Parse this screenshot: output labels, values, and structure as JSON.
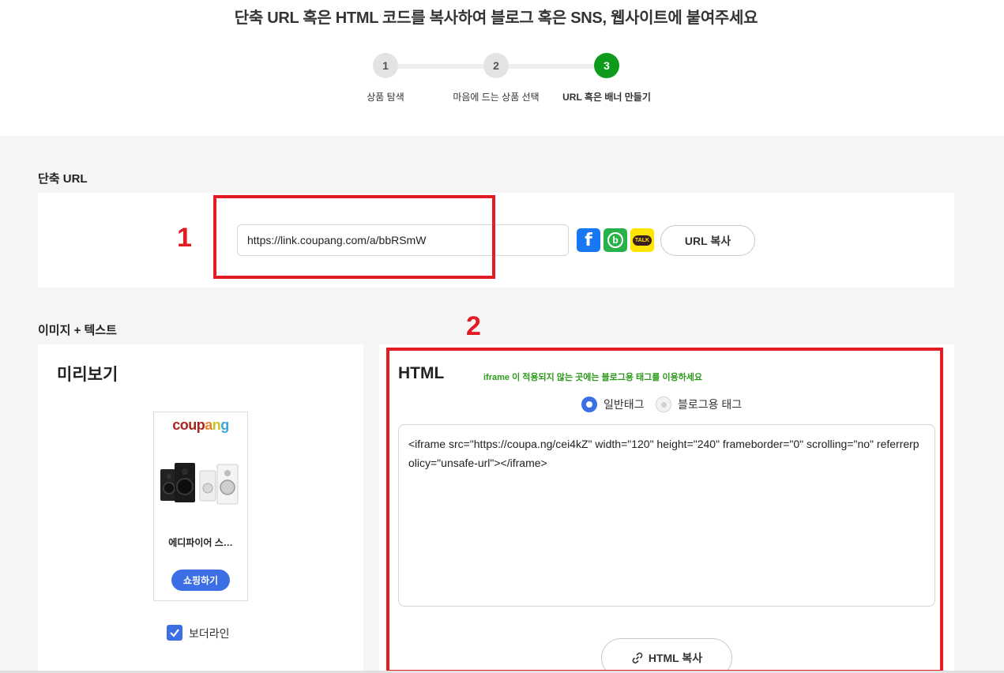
{
  "header": {
    "title": "단축 URL 혹은 HTML 코드를 복사하여 블로그 혹은 SNS, 웹사이트에 붙여주세요",
    "steps": [
      {
        "number": "1",
        "label": "상품 탐색",
        "active": false
      },
      {
        "number": "2",
        "label": "마음에 드는 상품 선택",
        "active": false
      },
      {
        "number": "3",
        "label": "URL 혹은 배너 만들기",
        "active": true
      }
    ]
  },
  "short_url": {
    "section_title": "단축 URL",
    "value": "https://link.coupang.com/a/bbRSmW",
    "share_icons": [
      "facebook-icon",
      "band-icon",
      "kakaotalk-icon"
    ],
    "kakao_text": "TALK",
    "copy_label": "URL 복사"
  },
  "image_text": {
    "section_title": "이미지 + 텍스트",
    "preview": {
      "title": "미리보기",
      "logo": "coupang",
      "product_name": "에디파이어 스…",
      "shop_button": "쇼핑하기",
      "border_checkbox_label": "보더라인",
      "border_checked": true
    },
    "html": {
      "title": "HTML",
      "note": "iframe 이 적용되지 않는 곳에는 블로그용 태그를 이용하세요",
      "radio_normal": "일반태그",
      "radio_blog": "블로그용 태그",
      "selected": "일반태그",
      "code": "<iframe src=\"https://coupa.ng/cei4kZ\" width=\"120\" height=\"240\" frameborder=\"0\" scrolling=\"no\" referrerpolicy=\"unsafe-url\"></iframe>",
      "copy_label": "HTML 복사"
    }
  },
  "annotations": {
    "num1": "1",
    "num2": "2"
  },
  "colors": {
    "active_step": "#0e9a1d",
    "accent_blue": "#3c6ee6",
    "annotation_red": "#e31b23",
    "note_green": "#2b9a1a"
  }
}
